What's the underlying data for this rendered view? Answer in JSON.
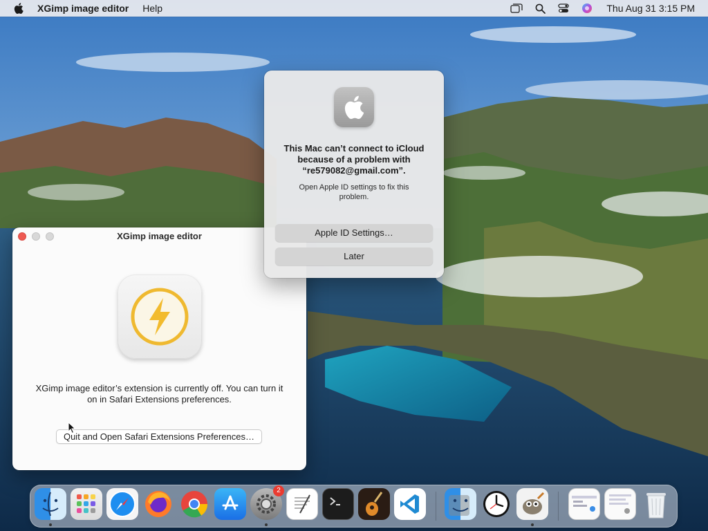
{
  "menubar": {
    "app_name": "XGimp image editor",
    "menus": [
      "Help"
    ],
    "clock": "Thu Aug 31  3:15 PM",
    "status_icons": [
      "window-overlap-icon",
      "search-icon",
      "control-center-icon",
      "siri-icon"
    ]
  },
  "app_window": {
    "title": "XGimp image editor",
    "message": "XGimp image editor’s extension is currently off. You can turn it on in Safari Extensions preferences.",
    "button_label": "Quit and Open Safari Extensions Preferences…",
    "icon": "lightning-bolt-icon"
  },
  "alert": {
    "title": "This Mac can’t connect to iCloud because of a problem with “re579082@gmail.com”.",
    "body": "Open Apple ID settings to fix this problem.",
    "primary_button": "Apple ID Settings…",
    "secondary_button": "Later",
    "icon": "apple-logo-icon"
  },
  "dock": {
    "items": [
      {
        "name": "Finder",
        "icon": "finder-icon",
        "running": true
      },
      {
        "name": "Launchpad",
        "icon": "launchpad-icon",
        "running": false
      },
      {
        "name": "Safari",
        "icon": "safari-icon",
        "running": false
      },
      {
        "name": "Firefox",
        "icon": "firefox-icon",
        "running": false
      },
      {
        "name": "Chrome",
        "icon": "chrome-icon",
        "running": false
      },
      {
        "name": "App Store",
        "icon": "app-store-icon",
        "running": false
      },
      {
        "name": "System Preferences",
        "icon": "system-preferences-icon",
        "running": true,
        "badge": "2"
      },
      {
        "name": "TextEdit",
        "icon": "textedit-icon",
        "running": false
      },
      {
        "name": "Terminal",
        "icon": "terminal-icon",
        "running": false
      },
      {
        "name": "GarageBand",
        "icon": "guitar-icon",
        "running": false
      },
      {
        "name": "VS Code",
        "icon": "vscode-icon",
        "running": false
      },
      {
        "name": "Finder Alt",
        "icon": "finder-alt-icon",
        "running": false
      },
      {
        "name": "Clock",
        "icon": "clock-icon",
        "running": false
      },
      {
        "name": "GIMP",
        "icon": "gimp-icon",
        "running": true
      },
      {
        "name": "Screenshot 1",
        "icon": "document-thumbnail-icon",
        "running": false
      },
      {
        "name": "Screenshot 2",
        "icon": "document-thumbnail-icon",
        "running": false
      },
      {
        "name": "Trash",
        "icon": "trash-icon",
        "running": false
      }
    ]
  }
}
